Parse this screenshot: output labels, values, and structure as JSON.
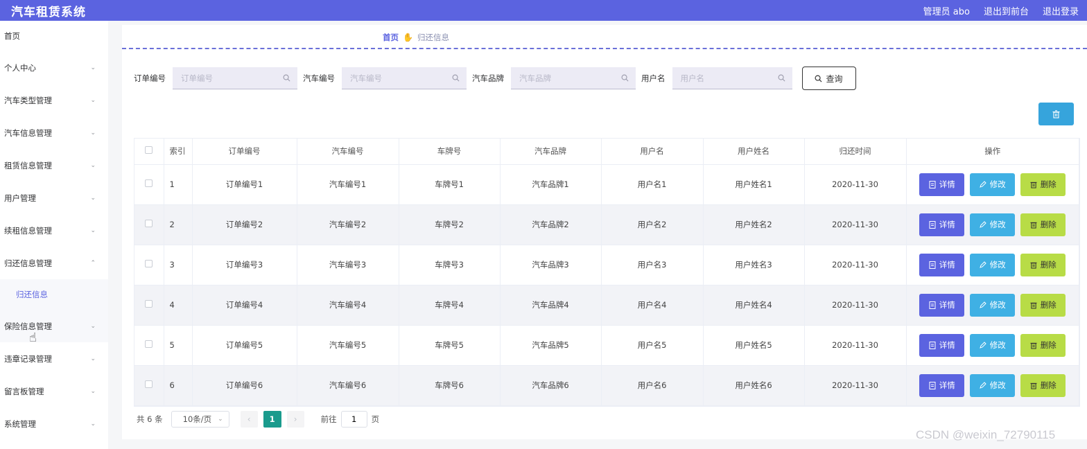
{
  "header": {
    "title": "汽车租赁系统",
    "user": "管理员 abo",
    "back_to_front": "退出到前台",
    "logout": "退出登录"
  },
  "sidebar": {
    "items": [
      {
        "label": "首页"
      },
      {
        "label": "个人中心"
      },
      {
        "label": "汽车类型管理"
      },
      {
        "label": "汽车信息管理"
      },
      {
        "label": "租赁信息管理"
      },
      {
        "label": "用户管理"
      },
      {
        "label": "续租信息管理"
      },
      {
        "label": "归还信息管理"
      },
      {
        "label": "保险信息管理"
      },
      {
        "label": "违章记录管理"
      },
      {
        "label": "留言板管理"
      },
      {
        "label": "系统管理"
      }
    ],
    "submenu": {
      "label": "归还信息"
    }
  },
  "breadcrumb": {
    "home": "首页",
    "current": "归还信息"
  },
  "search": {
    "order_label": "订单编号",
    "order_placeholder": "订单编号",
    "car_label": "汽车编号",
    "car_placeholder": "汽车编号",
    "brand_label": "汽车品牌",
    "brand_placeholder": "汽车品牌",
    "user_label": "用户名",
    "user_placeholder": "用户名",
    "query_label": "查询"
  },
  "table": {
    "columns": [
      "索引",
      "订单编号",
      "汽车编号",
      "车牌号",
      "汽车品牌",
      "用户名",
      "用户姓名",
      "归还时间",
      "操作"
    ],
    "rows": [
      {
        "idx": "1",
        "order": "订单编号1",
        "car": "汽车编号1",
        "plate": "车牌号1",
        "brand": "汽车品牌1",
        "user": "用户名1",
        "name": "用户姓名1",
        "time": "2020-11-30"
      },
      {
        "idx": "2",
        "order": "订单编号2",
        "car": "汽车编号2",
        "plate": "车牌号2",
        "brand": "汽车品牌2",
        "user": "用户名2",
        "name": "用户姓名2",
        "time": "2020-11-30"
      },
      {
        "idx": "3",
        "order": "订单编号3",
        "car": "汽车编号3",
        "plate": "车牌号3",
        "brand": "汽车品牌3",
        "user": "用户名3",
        "name": "用户姓名3",
        "time": "2020-11-30"
      },
      {
        "idx": "4",
        "order": "订单编号4",
        "car": "汽车编号4",
        "plate": "车牌号4",
        "brand": "汽车品牌4",
        "user": "用户名4",
        "name": "用户姓名4",
        "time": "2020-11-30"
      },
      {
        "idx": "5",
        "order": "订单编号5",
        "car": "汽车编号5",
        "plate": "车牌号5",
        "brand": "汽车品牌5",
        "user": "用户名5",
        "name": "用户姓名5",
        "time": "2020-11-30"
      },
      {
        "idx": "6",
        "order": "订单编号6",
        "car": "汽车编号6",
        "plate": "车牌号6",
        "brand": "汽车品牌6",
        "user": "用户名6",
        "name": "用户姓名6",
        "time": "2020-11-30"
      }
    ],
    "actions": {
      "detail": "详情",
      "edit": "修改",
      "delete": "删除"
    }
  },
  "pagination": {
    "total": "共 6 条",
    "page_size": "10条/页",
    "current_page": "1",
    "goto_label": "前往",
    "goto_value": "1",
    "page_suffix": "页"
  },
  "watermark": "CSDN @weixin_72790115",
  "colors": {
    "primary": "#5b63e0",
    "info": "#3fb0e4",
    "lime": "#b8dc46",
    "teal": "#1a9b8d"
  },
  "icons": {
    "search": "search-icon",
    "trash": "trash-icon",
    "detail": "document-icon",
    "edit": "pencil-icon",
    "chevron": "chevron-down-icon"
  }
}
